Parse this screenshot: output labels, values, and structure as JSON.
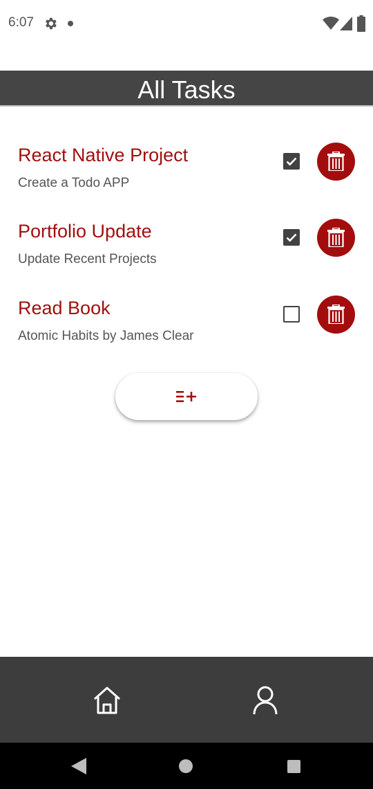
{
  "status_bar": {
    "time": "6:07",
    "icons": [
      "gear-icon",
      "notification-dot-icon",
      "wifi-icon",
      "signal-icon",
      "battery-icon"
    ]
  },
  "header": {
    "title": "All Tasks"
  },
  "tasks": [
    {
      "title": "React Native Project",
      "description": "Create a Todo APP",
      "completed": true
    },
    {
      "title": "Portfolio Update",
      "description": "Update Recent Projects",
      "completed": true
    },
    {
      "title": "Read Book",
      "description": "Atomic Habits by James Clear",
      "completed": false
    }
  ],
  "add_button": {
    "icon": "add-task-icon"
  },
  "bottom_nav": {
    "items": [
      {
        "icon": "home-icon"
      },
      {
        "icon": "profile-icon"
      }
    ]
  },
  "system_nav": {
    "buttons": [
      "back-icon",
      "home-circle-icon",
      "recents-icon"
    ]
  },
  "colors": {
    "accent": "#a10f0f",
    "header_bg": "#454545",
    "bottom_nav_bg": "#3d3d3d",
    "checkbox": "#424242"
  }
}
